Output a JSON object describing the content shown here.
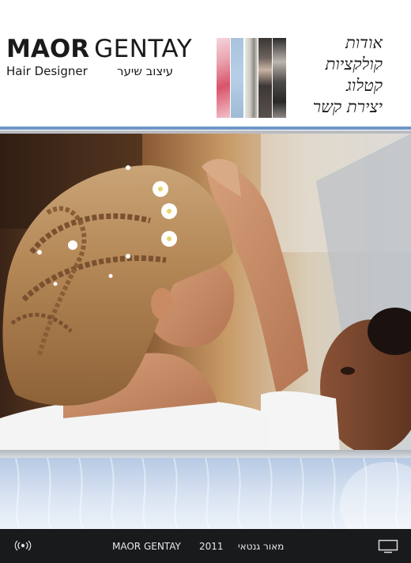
{
  "brand": {
    "name_bold": "MAOR",
    "name_light": "GENTAY",
    "tagline_en": "Hair Designer",
    "tagline_he": "עיצוב שיער"
  },
  "nav": {
    "items": [
      {
        "label": "אודות"
      },
      {
        "label": "קולקציות"
      },
      {
        "label": "קטלוג"
      },
      {
        "label": "יצירת קשר"
      }
    ]
  },
  "hero": {
    "alt": "hair-styling-photo"
  },
  "footer": {
    "brand": "MAOR GENTAY",
    "year": "2011",
    "brand_he": "מאור גנטאי"
  },
  "colors": {
    "accent_blue": "#6f95c7",
    "divider_grey": "#b9bcc1",
    "footer_bg": "#191a1c"
  },
  "icons": {
    "sound": "sound-icon",
    "fullscreen": "screen-icon"
  }
}
